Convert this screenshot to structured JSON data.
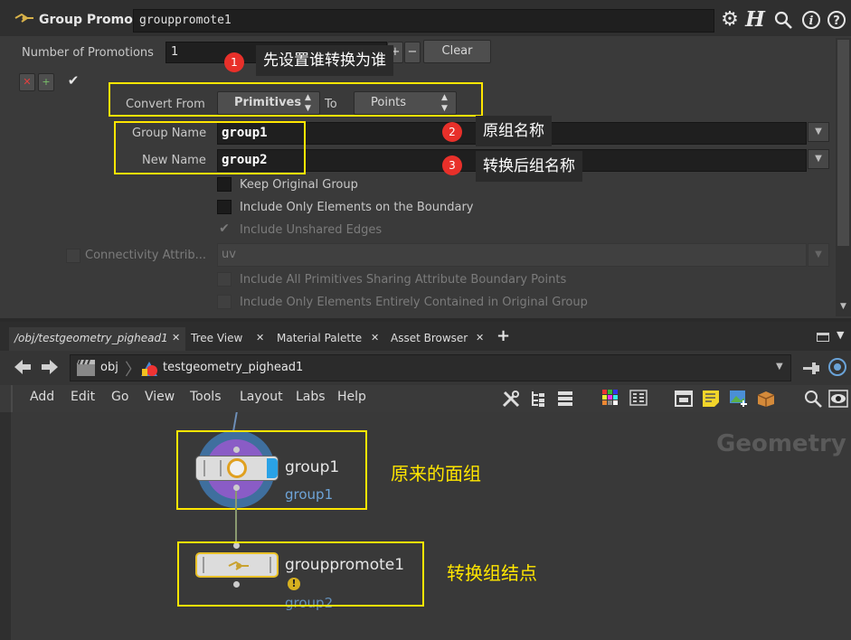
{
  "header": {
    "node_type": "Group Promote",
    "node_name": "grouppromote1",
    "icons": [
      "gear-icon",
      "help-h-icon",
      "search-icon",
      "info-icon",
      "question-icon"
    ]
  },
  "params": {
    "num_promotions_label": "Number of Promotions",
    "num_promotions_value": "1",
    "clear_label": "Clear",
    "convert_from_label": "Convert From",
    "convert_from_value": "Primitives",
    "to_label": "To",
    "to_value": "Points",
    "group_name_label": "Group Name",
    "group_name_value": "group1",
    "new_name_label": "New Name",
    "new_name_value": "group2",
    "keep_original": "Keep Original Group",
    "include_boundary": "Include Only Elements on the Boundary",
    "include_unshared": "Include Unshared Edges",
    "connectivity_label": "Connectivity Attrib...",
    "connectivity_value": "uv",
    "include_all_prims": "Include All Primitives Sharing Attribute Boundary Points",
    "include_contained": "Include Only Elements Entirely Contained in Original Group"
  },
  "callouts": {
    "c1_num": "1",
    "c1_text": "先设置谁转换为谁",
    "c2_num": "2",
    "c2_text": "原组名称",
    "c3_num": "3",
    "c3_text": "转换后组名称"
  },
  "tabs": [
    {
      "label": "/obj/testgeometry_pighead1"
    },
    {
      "label": "Tree View"
    },
    {
      "label": "Material Palette"
    },
    {
      "label": "Asset Browser"
    }
  ],
  "path": {
    "obj": "obj",
    "node": "testgeometry_pighead1"
  },
  "menu": [
    "Add",
    "Edit",
    "Go",
    "View",
    "Tools",
    "Layout",
    "Labs",
    "Help"
  ],
  "network": {
    "context_label": "Geometry",
    "node1_name": "group1",
    "node1_sub": "group1",
    "node1_annotation": "原来的面组",
    "node2_name": "grouppromote1",
    "node2_sub": "group2",
    "node2_annotation": "转换组结点"
  },
  "colors": {
    "annotation": "#ffe600",
    "badge": "#e8302a",
    "group_sub": "#6ea4d8"
  }
}
